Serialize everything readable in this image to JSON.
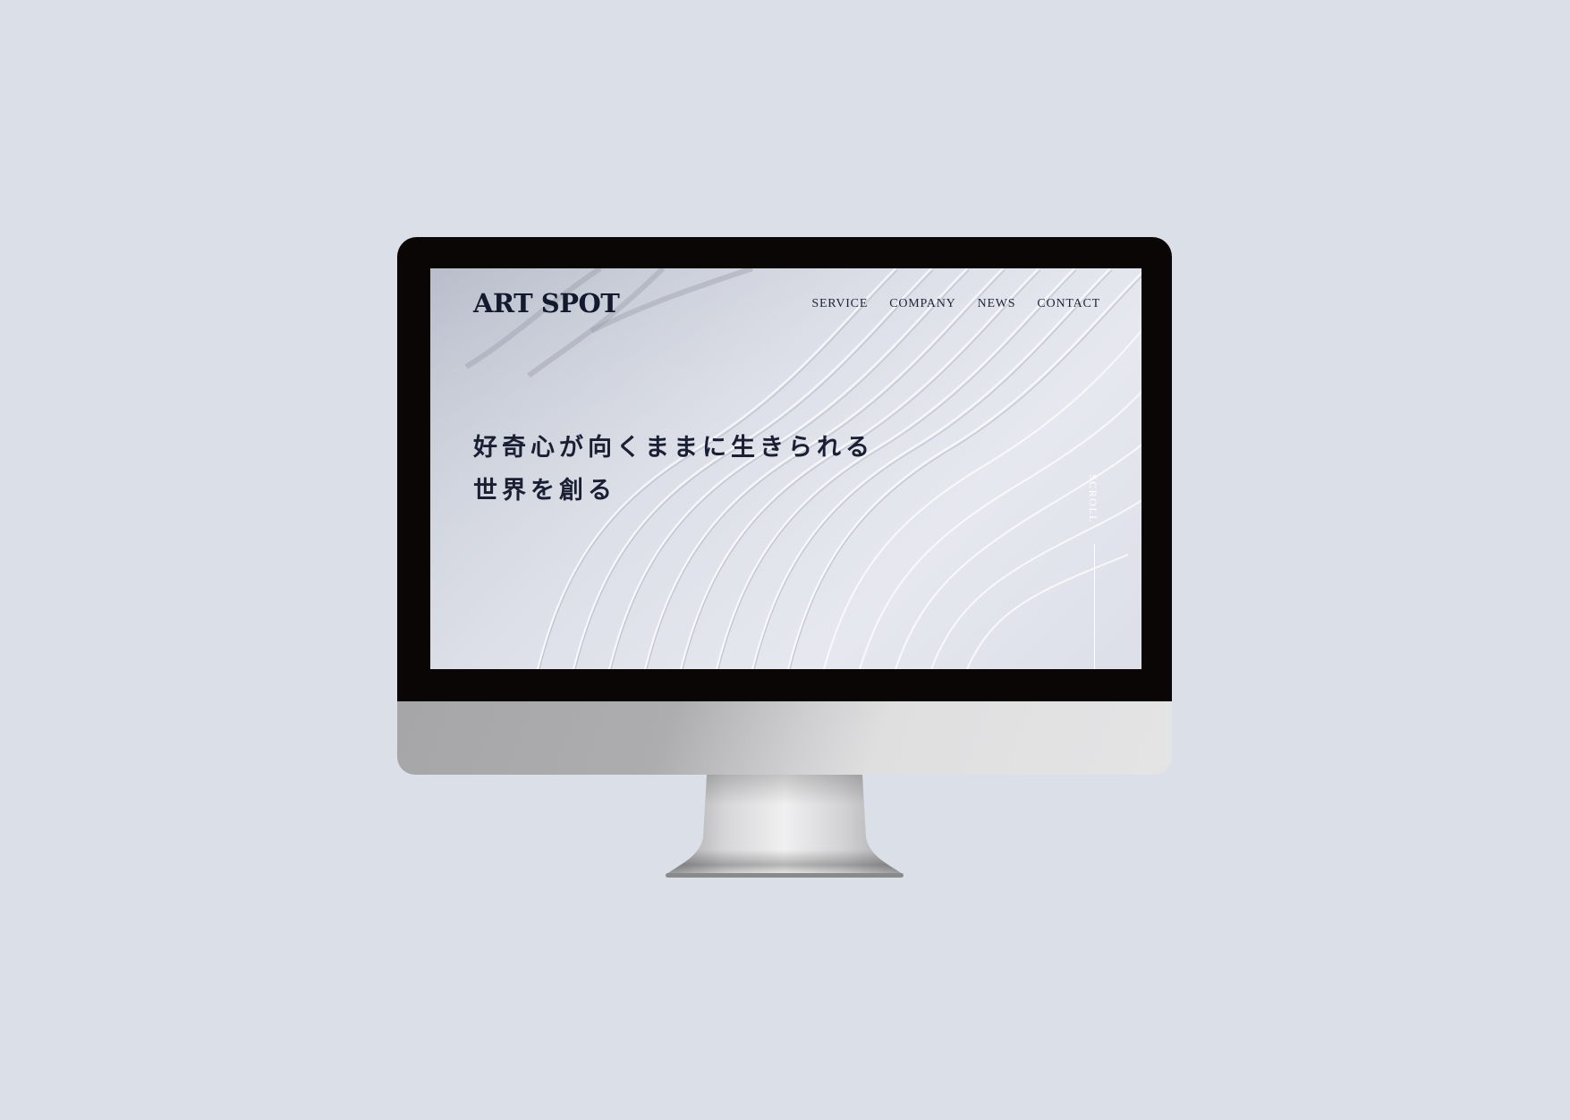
{
  "site": {
    "logo": "ART SPOT",
    "nav": [
      {
        "label": "SERVICE"
      },
      {
        "label": "COMPANY"
      },
      {
        "label": "NEWS"
      },
      {
        "label": "CONTACT"
      }
    ],
    "hero": {
      "line1": "好奇心が向くままに生きられる",
      "line2": "世界を創る"
    },
    "scroll_label": "SCROLL"
  },
  "colors": {
    "page_background": "#dbdfe8",
    "bezel": "#0a0606",
    "text_dark": "#1a1f33",
    "scroll_indicator": "#ffffff"
  }
}
